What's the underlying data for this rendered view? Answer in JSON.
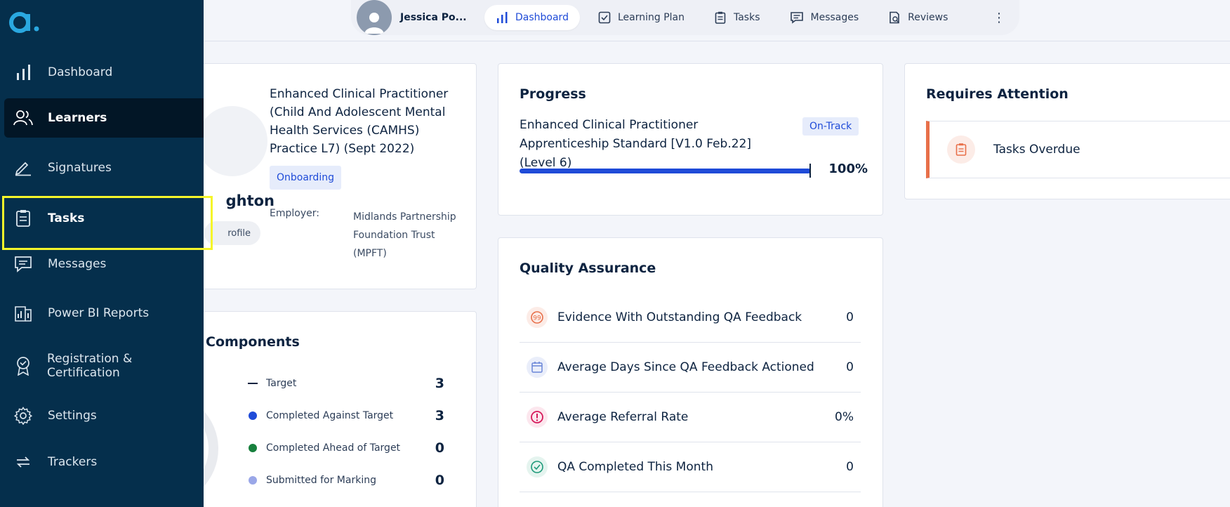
{
  "topnav": {
    "user_name": "Jessica Po...",
    "tabs": [
      {
        "label": "Dashboard",
        "icon": "chart-bars-icon",
        "active": true
      },
      {
        "label": "Learning Plan",
        "icon": "checkbox-icon"
      },
      {
        "label": "Tasks",
        "icon": "clipboard-icon"
      },
      {
        "label": "Messages",
        "icon": "chat-icon"
      },
      {
        "label": "Reviews",
        "icon": "review-icon"
      }
    ],
    "more_icon": "⋮"
  },
  "learner": {
    "surname_fragment": "ghton",
    "profile_fragment": "rofile",
    "course": "Enhanced Clinical Practitioner (Child And Adolescent Mental Health Services (CAMHS) Practice L7) (Sept 2022)",
    "status": "Onboarding",
    "employer_label": "Employer:",
    "employer": "Midlands Partnership Foundation Trust (MPFT)"
  },
  "components": {
    "title": "Components",
    "rows": [
      {
        "label": "Target",
        "value": "3",
        "marker": "line",
        "color": "#0d2340"
      },
      {
        "label": "Completed Against Target",
        "value": "3",
        "marker": "dot",
        "color": "#1f4bd8"
      },
      {
        "label": "Completed Ahead of Target",
        "value": "0",
        "marker": "dot",
        "color": "#17803d"
      },
      {
        "label": "Submitted for Marking",
        "value": "0",
        "marker": "dot",
        "color": "#9aa7e8"
      }
    ]
  },
  "progress": {
    "title": "Progress",
    "course": "Enhanced Clinical Practitioner Apprenticeship Standard [V1.0 Feb.22] (Level 6)",
    "badge": "On-Track",
    "percent_label": "100%",
    "percent": 100
  },
  "qa": {
    "title": "Quality Assurance",
    "rows": [
      {
        "label": "Evidence With Outstanding QA Feedback",
        "value": "0",
        "icon": "feedback-icon",
        "color": "#e8704a"
      },
      {
        "label": "Average Days Since QA Feedback Actioned",
        "value": "0",
        "icon": "calendar-icon",
        "color": "#6b86d8"
      },
      {
        "label": "Average Referral Rate",
        "value": "0%",
        "icon": "alert-icon",
        "color": "#d61a5b"
      },
      {
        "label": "QA Completed This Month",
        "value": "0",
        "icon": "check-circle-icon",
        "color": "#1e9a7a"
      }
    ]
  },
  "attention": {
    "title": "Requires Attention",
    "item": "Tasks Overdue"
  },
  "sidebar": {
    "logo": "a.",
    "items": [
      {
        "label": "Dashboard",
        "icon": "chart-bars-icon"
      },
      {
        "label": "Learners",
        "icon": "users-icon",
        "active": true
      },
      {
        "label": "Signatures",
        "icon": "pen-icon"
      },
      {
        "label": "Tasks",
        "icon": "clipboard-icon"
      },
      {
        "label": "Messages",
        "icon": "chat-icon"
      },
      {
        "label": "Power BI Reports",
        "icon": "report-icon"
      },
      {
        "label": "Registration & Certification",
        "icon": "badge-icon"
      },
      {
        "label": "Settings",
        "icon": "gear-icon"
      },
      {
        "label": "Trackers",
        "icon": "arrows-icon"
      }
    ]
  },
  "colors": {
    "sidebar_bg": "#052f4c",
    "accent": "#1f4bd8",
    "highlight": "#f5f52a"
  }
}
